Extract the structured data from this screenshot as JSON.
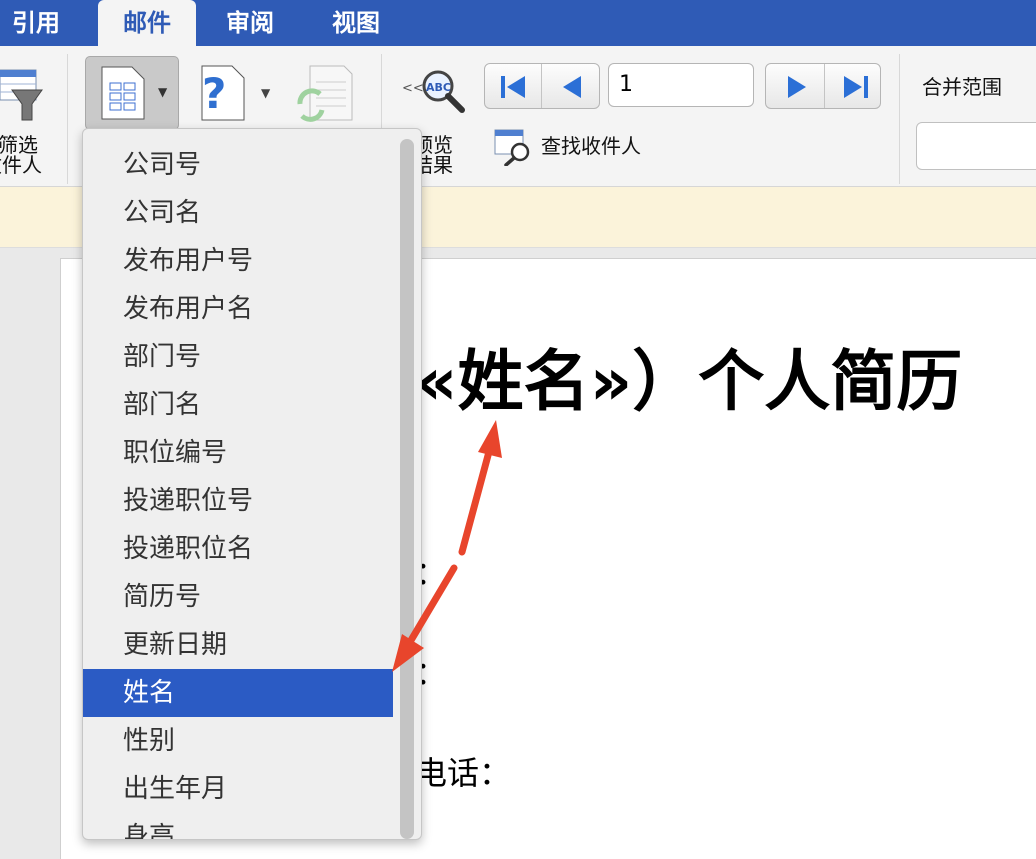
{
  "tabs": [
    "引用",
    "邮件",
    "审阅",
    "视图"
  ],
  "ribbon": {
    "filter_label_line1": "筛选",
    "filter_label_line2": "收件人",
    "preview_label_line1": "预览",
    "preview_label_line2": "结果",
    "find_recipient_label": "查找收件人",
    "record_number": "1",
    "merge_range_label": "合并范围"
  },
  "menu": {
    "items": [
      "公司号",
      "公司名",
      "发布用户号",
      "发布用户名",
      "部门号",
      "部门名",
      "职位编号",
      "投递职位号",
      "投递职位名",
      "简历号",
      "更新日期",
      "姓名",
      "性别",
      "出生年月",
      "身高"
    ],
    "selected_index": 11
  },
  "document": {
    "title": "«姓名»）个人简历",
    "line1": "：",
    "line2": "：",
    "line3": "电话："
  },
  "colors": {
    "tab_bar": "#2f5bb6",
    "selected_item": "#2b5bc4",
    "annotation_arrow": "#e8452c"
  }
}
